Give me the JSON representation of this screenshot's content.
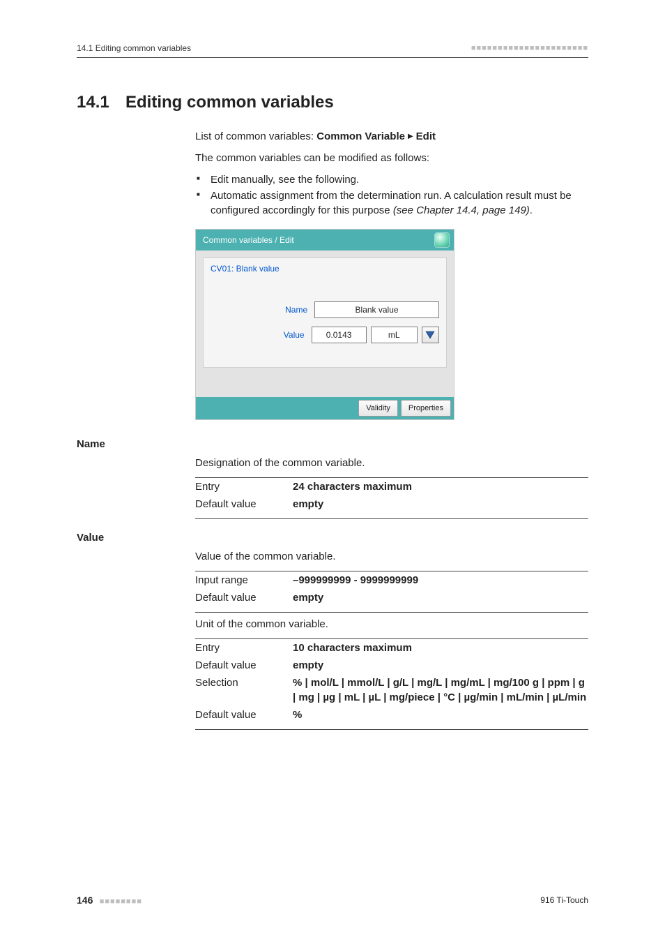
{
  "header": {
    "running_title": "14.1 Editing common variables",
    "section_number": "14.1",
    "section_title": "Editing common variables"
  },
  "intro": {
    "breadcrumb_prefix": "List of common variables: ",
    "breadcrumb_bold1": "Common Variable",
    "breadcrumb_bold2": "Edit",
    "sentence1": "The common variables can be modified as follows:",
    "bullet1": "Edit manually, see the following.",
    "bullet2a": "Automatic assignment from the determination run. A calculation result must be configured accordingly for this purpose ",
    "bullet2b_italic": "(see Chapter 14.4, page 149)",
    "bullet2c": "."
  },
  "screenshot": {
    "titlebar": "Common variables / Edit",
    "cv_line": "CV01: Blank value",
    "label_name": "Name",
    "label_value": "Value",
    "input_name": "Blank value",
    "input_value": "0.0143",
    "input_unit": "mL",
    "btn_validity": "Validity",
    "btn_properties": "Properties"
  },
  "defs": {
    "name": {
      "heading": "Name",
      "desc": "Designation of the common variable.",
      "rows": [
        {
          "k": "Entry",
          "v": "24 characters maximum",
          "vbold": true
        },
        {
          "k": "Default value",
          "v": "empty",
          "vbold": true
        }
      ]
    },
    "value": {
      "heading": "Value",
      "desc1": "Value of the common variable.",
      "rows1": [
        {
          "k": "Input range",
          "v": "–999999999 - 9999999999",
          "vbold": true
        },
        {
          "k": "Default value",
          "v": "empty",
          "vbold": true
        }
      ],
      "desc2": "Unit of the common variable.",
      "rows2": [
        {
          "k": "Entry",
          "v": "10 characters maximum",
          "vbold": true
        },
        {
          "k": "Default value",
          "v": "empty",
          "vbold": true
        },
        {
          "k": "Selection",
          "v": "% | mol/L | mmol/L | g/L | mg/L | mg/mL | mg/100 g | ppm | g | mg | µg | mL | µL | mg/piece | °C | µg/min | mL/min | µL/min",
          "vbold": true
        },
        {
          "k": "Default value",
          "v": "%",
          "vbold": true
        }
      ]
    }
  },
  "footer": {
    "page_number": "146",
    "product": "916 Ti-Touch"
  }
}
